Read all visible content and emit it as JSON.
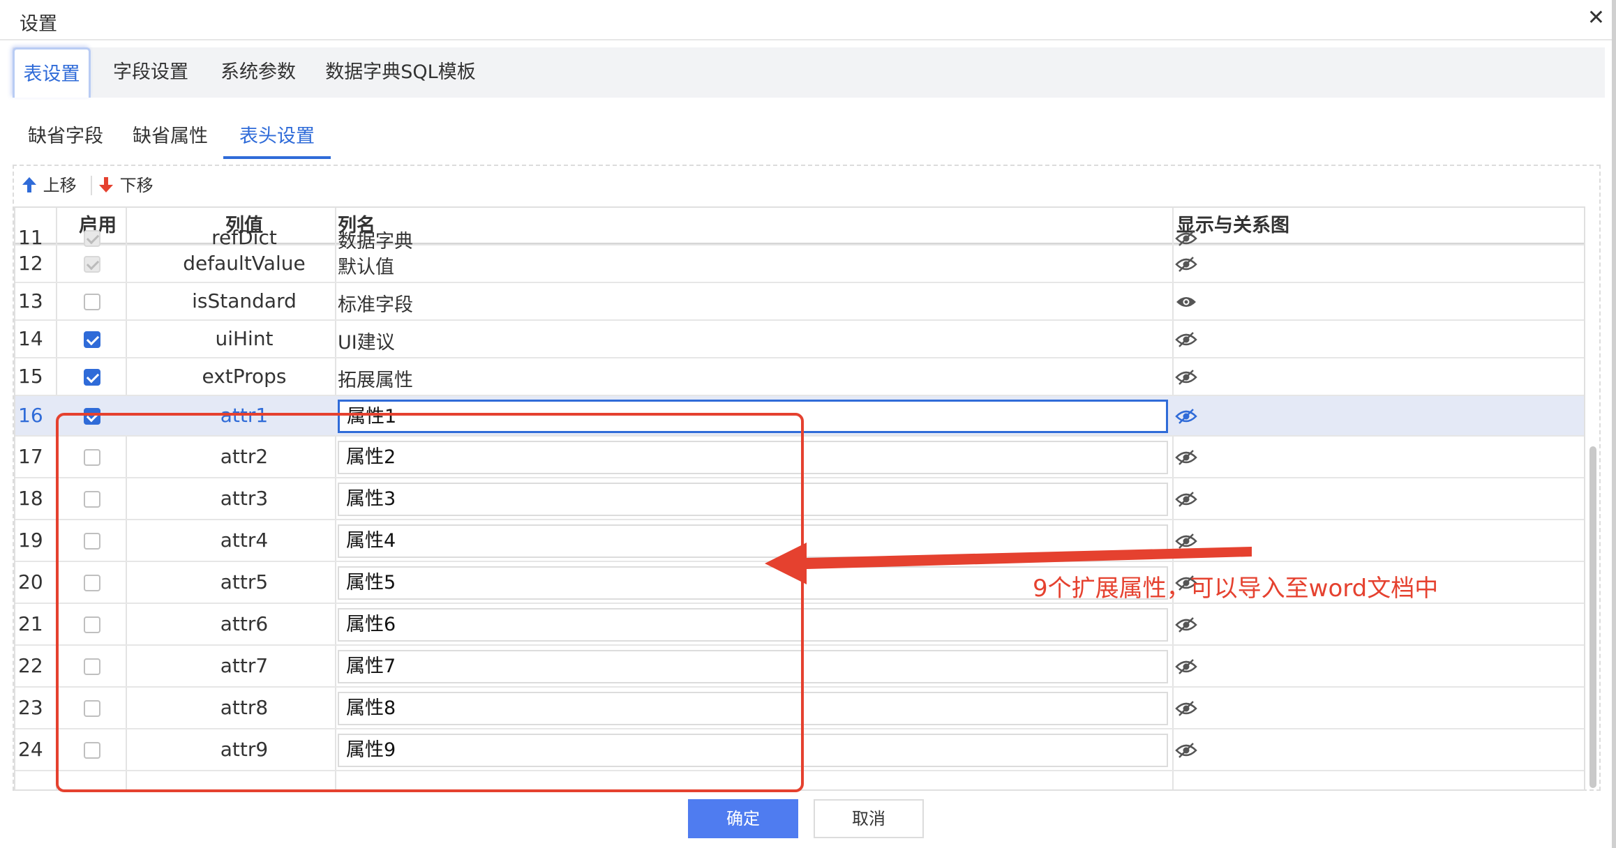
{
  "dialog": {
    "title": "设置"
  },
  "tabs": [
    "表设置",
    "字段设置",
    "系统参数",
    "数据字典SQL模板"
  ],
  "subtabs": [
    "缺省字段",
    "缺省属性",
    "表头设置"
  ],
  "toolbar": {
    "move_up": "上移",
    "move_down": "下移"
  },
  "columns": {
    "enable": "启用",
    "value": "列值",
    "name": "列名",
    "display": "显示与关系图"
  },
  "rows": [
    {
      "no": "11",
      "enabled": "disabled",
      "value": "refDict",
      "name": "数据字典",
      "eye": "hidden"
    },
    {
      "no": "12",
      "enabled": "disabled",
      "value": "defaultValue",
      "name": "默认值",
      "eye": "hidden"
    },
    {
      "no": "13",
      "enabled": "unchecked",
      "value": "isStandard",
      "name": "标准字段",
      "eye": "visible"
    },
    {
      "no": "14",
      "enabled": "checked",
      "value": "uiHint",
      "name": "UI建议",
      "eye": "hidden"
    },
    {
      "no": "15",
      "enabled": "checked",
      "value": "extProps",
      "name": "拓展属性",
      "eye": "hidden"
    },
    {
      "no": "16",
      "enabled": "checked",
      "value": "attr1",
      "name": "属性1",
      "eye": "hidden",
      "selected": true,
      "editable": true
    },
    {
      "no": "17",
      "enabled": "unchecked",
      "value": "attr2",
      "name": "属性2",
      "eye": "hidden",
      "editable": true
    },
    {
      "no": "18",
      "enabled": "unchecked",
      "value": "attr3",
      "name": "属性3",
      "eye": "hidden",
      "editable": true
    },
    {
      "no": "19",
      "enabled": "unchecked",
      "value": "attr4",
      "name": "属性4",
      "eye": "hidden",
      "editable": true
    },
    {
      "no": "20",
      "enabled": "unchecked",
      "value": "attr5",
      "name": "属性5",
      "eye": "hidden",
      "editable": true
    },
    {
      "no": "21",
      "enabled": "unchecked",
      "value": "attr6",
      "name": "属性6",
      "eye": "hidden",
      "editable": true
    },
    {
      "no": "22",
      "enabled": "unchecked",
      "value": "attr7",
      "name": "属性7",
      "eye": "hidden",
      "editable": true
    },
    {
      "no": "23",
      "enabled": "unchecked",
      "value": "attr8",
      "name": "属性8",
      "eye": "hidden",
      "editable": true
    },
    {
      "no": "24",
      "enabled": "unchecked",
      "value": "attr9",
      "name": "属性9",
      "eye": "hidden",
      "editable": true
    }
  ],
  "annotation": {
    "text": "9个扩展属性，可以导入至word文档中",
    "color": "#e5412f"
  },
  "buttons": {
    "ok": "确定",
    "cancel": "取消"
  },
  "colors": {
    "accent": "#2f6bd8",
    "primary_button": "#4f7cf0",
    "annotation": "#e5412f",
    "up_arrow": "#2f6bd8",
    "down_arrow": "#e5412f"
  }
}
